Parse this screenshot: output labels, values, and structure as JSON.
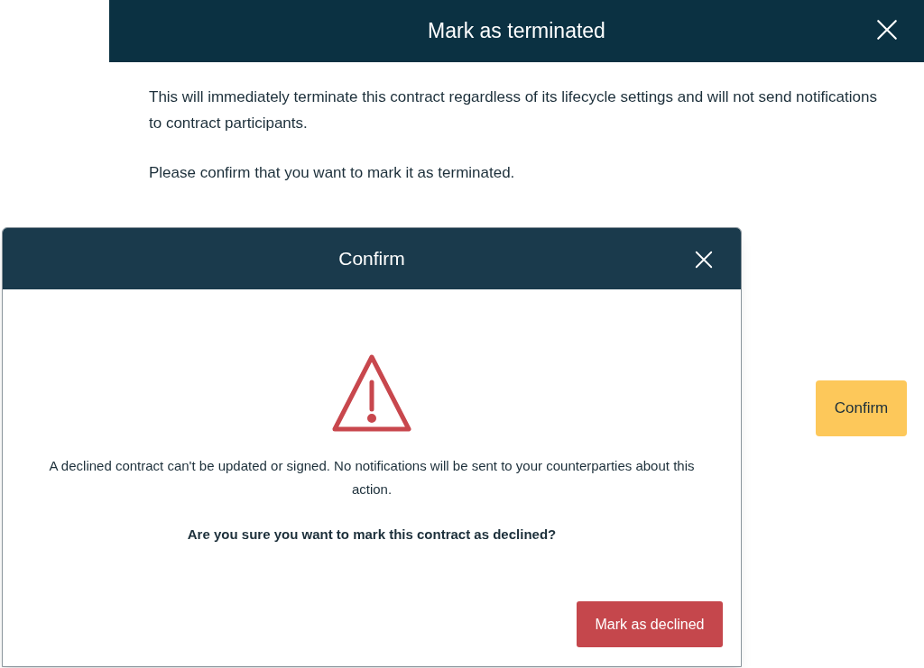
{
  "back_dialog": {
    "title": "Mark as terminated",
    "paragraphs": [
      "This will immediately terminate this contract regardless of its lifecycle settings and will not send notifications to contract participants.",
      "Please confirm that you want to mark it as terminated."
    ],
    "button": "Confirm"
  },
  "front_dialog": {
    "title": "Confirm",
    "message": "A declined contract can't be updated or signed. No notifications will be sent to your counterparties about this action.",
    "question": "Are you sure you want to mark this contract as declined?",
    "button": "Mark as declined"
  }
}
